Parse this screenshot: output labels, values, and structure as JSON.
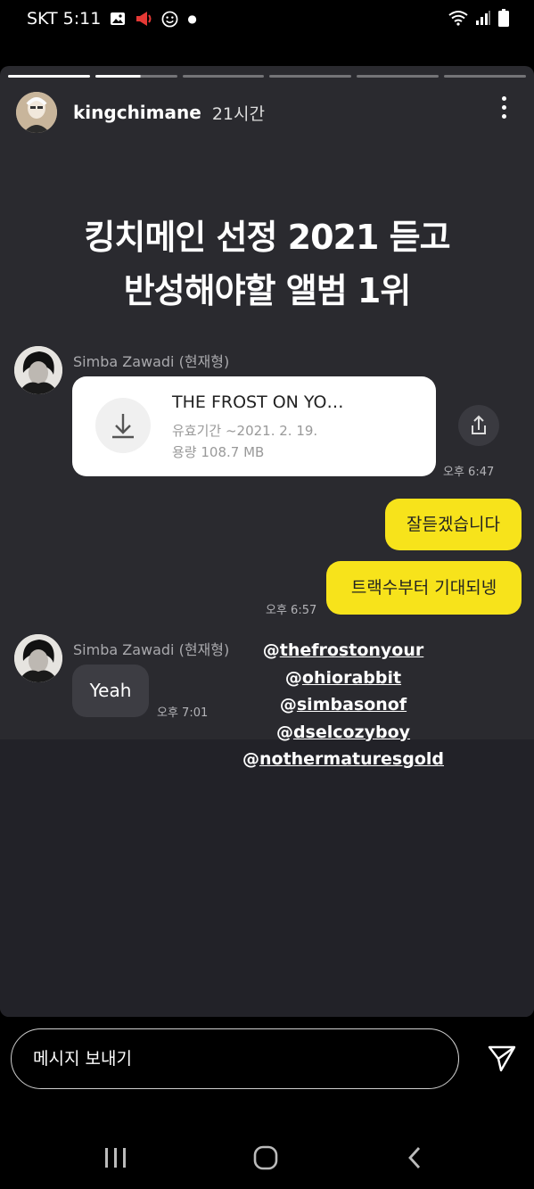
{
  "status_bar": {
    "carrier": "SKT",
    "time": "5:11"
  },
  "story": {
    "progress_segments": 6,
    "progress_done": 2,
    "username": "kingchimane",
    "time_ago": "21시간",
    "headline_line1": "킹치메인 선정 2021 듣고",
    "headline_line2": "반성해야할 앨범 1위"
  },
  "chat": {
    "sender1": "Simba Zawadi (현재형)",
    "file": {
      "title": "THE FROST ON YO…",
      "expiry": "유효기간 ~2021. 2. 19.",
      "size": "용량 108.7 MB"
    },
    "time1": "오후 6:47",
    "reply1": "잘듣겠습니다",
    "reply2": "트랙수부터 기대되넹",
    "time2": "오후 6:57",
    "sender2": "Simba Zawadi (현재형)",
    "msg3": "Yeah",
    "time3": "오후 7:01"
  },
  "mentions": [
    {
      "at": "@",
      "handle": "thefrostonyour"
    },
    {
      "at": "@",
      "handle": "ohiorabbit"
    },
    {
      "at": "@",
      "handle": "simbasonof"
    },
    {
      "at": "@",
      "handle": "dselcozyboy"
    },
    {
      "at": "@",
      "handle": "nothermaturesgold"
    }
  ],
  "message_bar": {
    "placeholder": "메시지 보내기"
  },
  "colors": {
    "bubble_yellow": "#f7e31b",
    "story_bg": "#2a2a2f",
    "alert_red": "#e53935"
  },
  "icons": [
    "image-icon",
    "megaphone-icon",
    "smiley-icon",
    "wifi-icon",
    "signal-icon",
    "battery-icon",
    "more-icon",
    "download-icon",
    "share-icon",
    "send-icon",
    "recents-icon",
    "home-icon",
    "back-icon"
  ]
}
